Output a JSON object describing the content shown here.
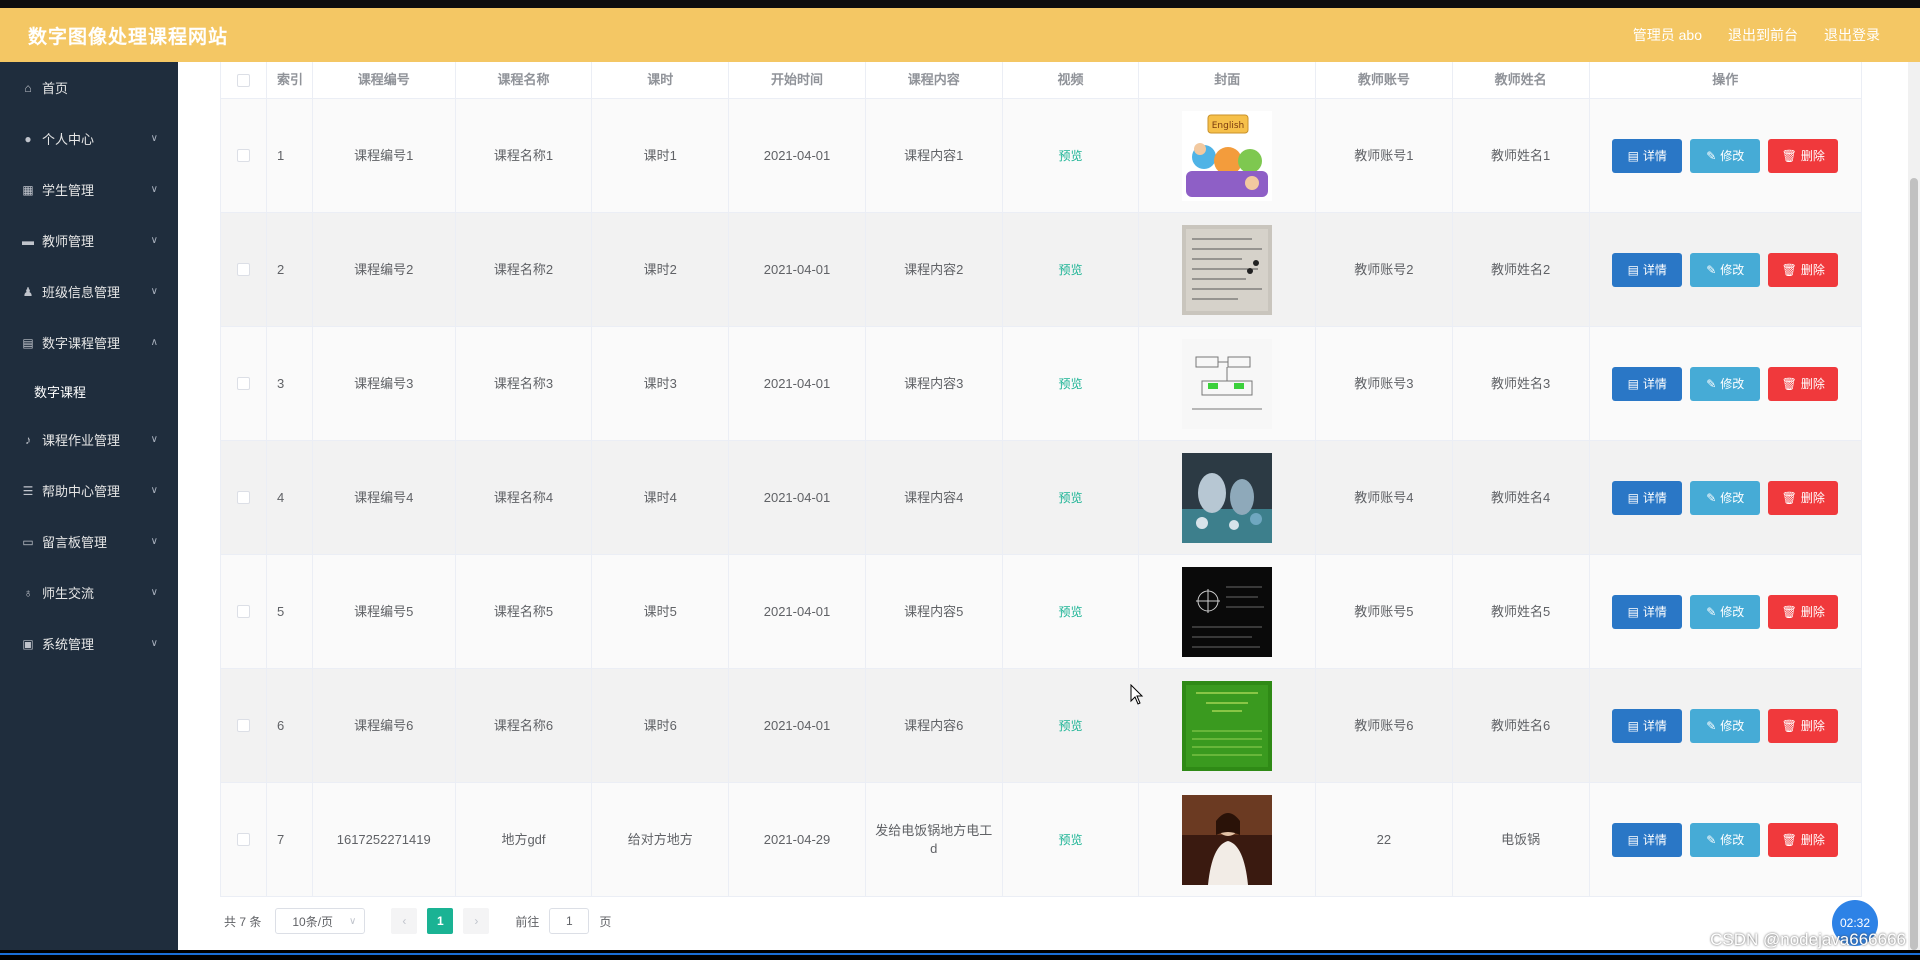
{
  "header": {
    "title": "数字图像处理课程网站",
    "admin": "管理员 abo",
    "front": "退出到前台",
    "logout": "退出登录"
  },
  "sidebar": {
    "items": [
      {
        "label": "首页",
        "icon": "home-icon"
      },
      {
        "label": "个人中心",
        "icon": "user-icon"
      },
      {
        "label": "学生管理",
        "icon": "grid-icon"
      },
      {
        "label": "教师管理",
        "icon": "briefcase-icon"
      },
      {
        "label": "班级信息管理",
        "icon": "stamp-icon"
      },
      {
        "label": "数字课程管理",
        "icon": "book-icon"
      },
      {
        "label": "课程作业管理",
        "icon": "bell-icon"
      },
      {
        "label": "帮助中心管理",
        "icon": "sliders-icon"
      },
      {
        "label": "留言板管理",
        "icon": "monitor-icon"
      },
      {
        "label": "师生交流",
        "icon": "mic-icon"
      },
      {
        "label": "系统管理",
        "icon": "chat-icon"
      }
    ],
    "sub_item": "数字课程"
  },
  "table": {
    "headers": [
      "索引",
      "课程编号",
      "课程名称",
      "课时",
      "开始时间",
      "课程内容",
      "视频",
      "封面",
      "教师账号",
      "教师姓名",
      "操作"
    ],
    "rows": [
      {
        "idx": "1",
        "code": "课程编号1",
        "name": "课程名称1",
        "hours": "课时1",
        "start": "2021-04-01",
        "content": "课程内容1",
        "video": "预览",
        "tacct": "教师账号1",
        "tname": "教师姓名1",
        "cover": "cartoon"
      },
      {
        "idx": "2",
        "code": "课程编号2",
        "name": "课程名称2",
        "hours": "课时2",
        "start": "2021-04-01",
        "content": "课程内容2",
        "video": "预览",
        "tacct": "教师账号2",
        "tname": "教师姓名2",
        "cover": "paper"
      },
      {
        "idx": "3",
        "code": "课程编号3",
        "name": "课程名称3",
        "hours": "课时3",
        "start": "2021-04-01",
        "content": "课程内容3",
        "video": "预览",
        "tacct": "教师账号3",
        "tname": "教师姓名3",
        "cover": "diagram"
      },
      {
        "idx": "4",
        "code": "课程编号4",
        "name": "课程名称4",
        "hours": "课时4",
        "start": "2021-04-01",
        "content": "课程内容4",
        "video": "预览",
        "tacct": "教师账号4",
        "tname": "教师姓名4",
        "cover": "photo"
      },
      {
        "idx": "5",
        "code": "课程编号5",
        "name": "课程名称5",
        "hours": "课时5",
        "start": "2021-04-01",
        "content": "课程内容5",
        "video": "预览",
        "tacct": "教师账号5",
        "tname": "教师姓名5",
        "cover": "blackboard"
      },
      {
        "idx": "6",
        "code": "课程编号6",
        "name": "课程名称6",
        "hours": "课时6",
        "start": "2021-04-01",
        "content": "课程内容6",
        "video": "预览",
        "tacct": "教师账号6",
        "tname": "教师姓名6",
        "cover": "greenslide"
      },
      {
        "idx": "7",
        "code": "1617252271419",
        "name": "地方gdf",
        "hours": "给对方地方",
        "start": "2021-04-29",
        "content": "发给电饭锅地方电工d",
        "video": "预览",
        "tacct": "22",
        "tname": "电饭锅",
        "cover": "portrait"
      }
    ],
    "actions": {
      "detail": "详情",
      "edit": "修改",
      "delete": "删除"
    }
  },
  "pager": {
    "total": "共 7 条",
    "size": "10条/页",
    "current": "1",
    "goto": "前往",
    "goto_value": "1",
    "page_unit": "页"
  },
  "overlay": {
    "timer": "02:32",
    "watermark": "CSDN @nodejava666666"
  },
  "colors": {
    "header": "#f4c764",
    "sidebar": "#1f2d3d",
    "primary": "#1ab394",
    "detail": "#2a77c6",
    "edit": "#46abd6",
    "delete": "#f0393c"
  }
}
